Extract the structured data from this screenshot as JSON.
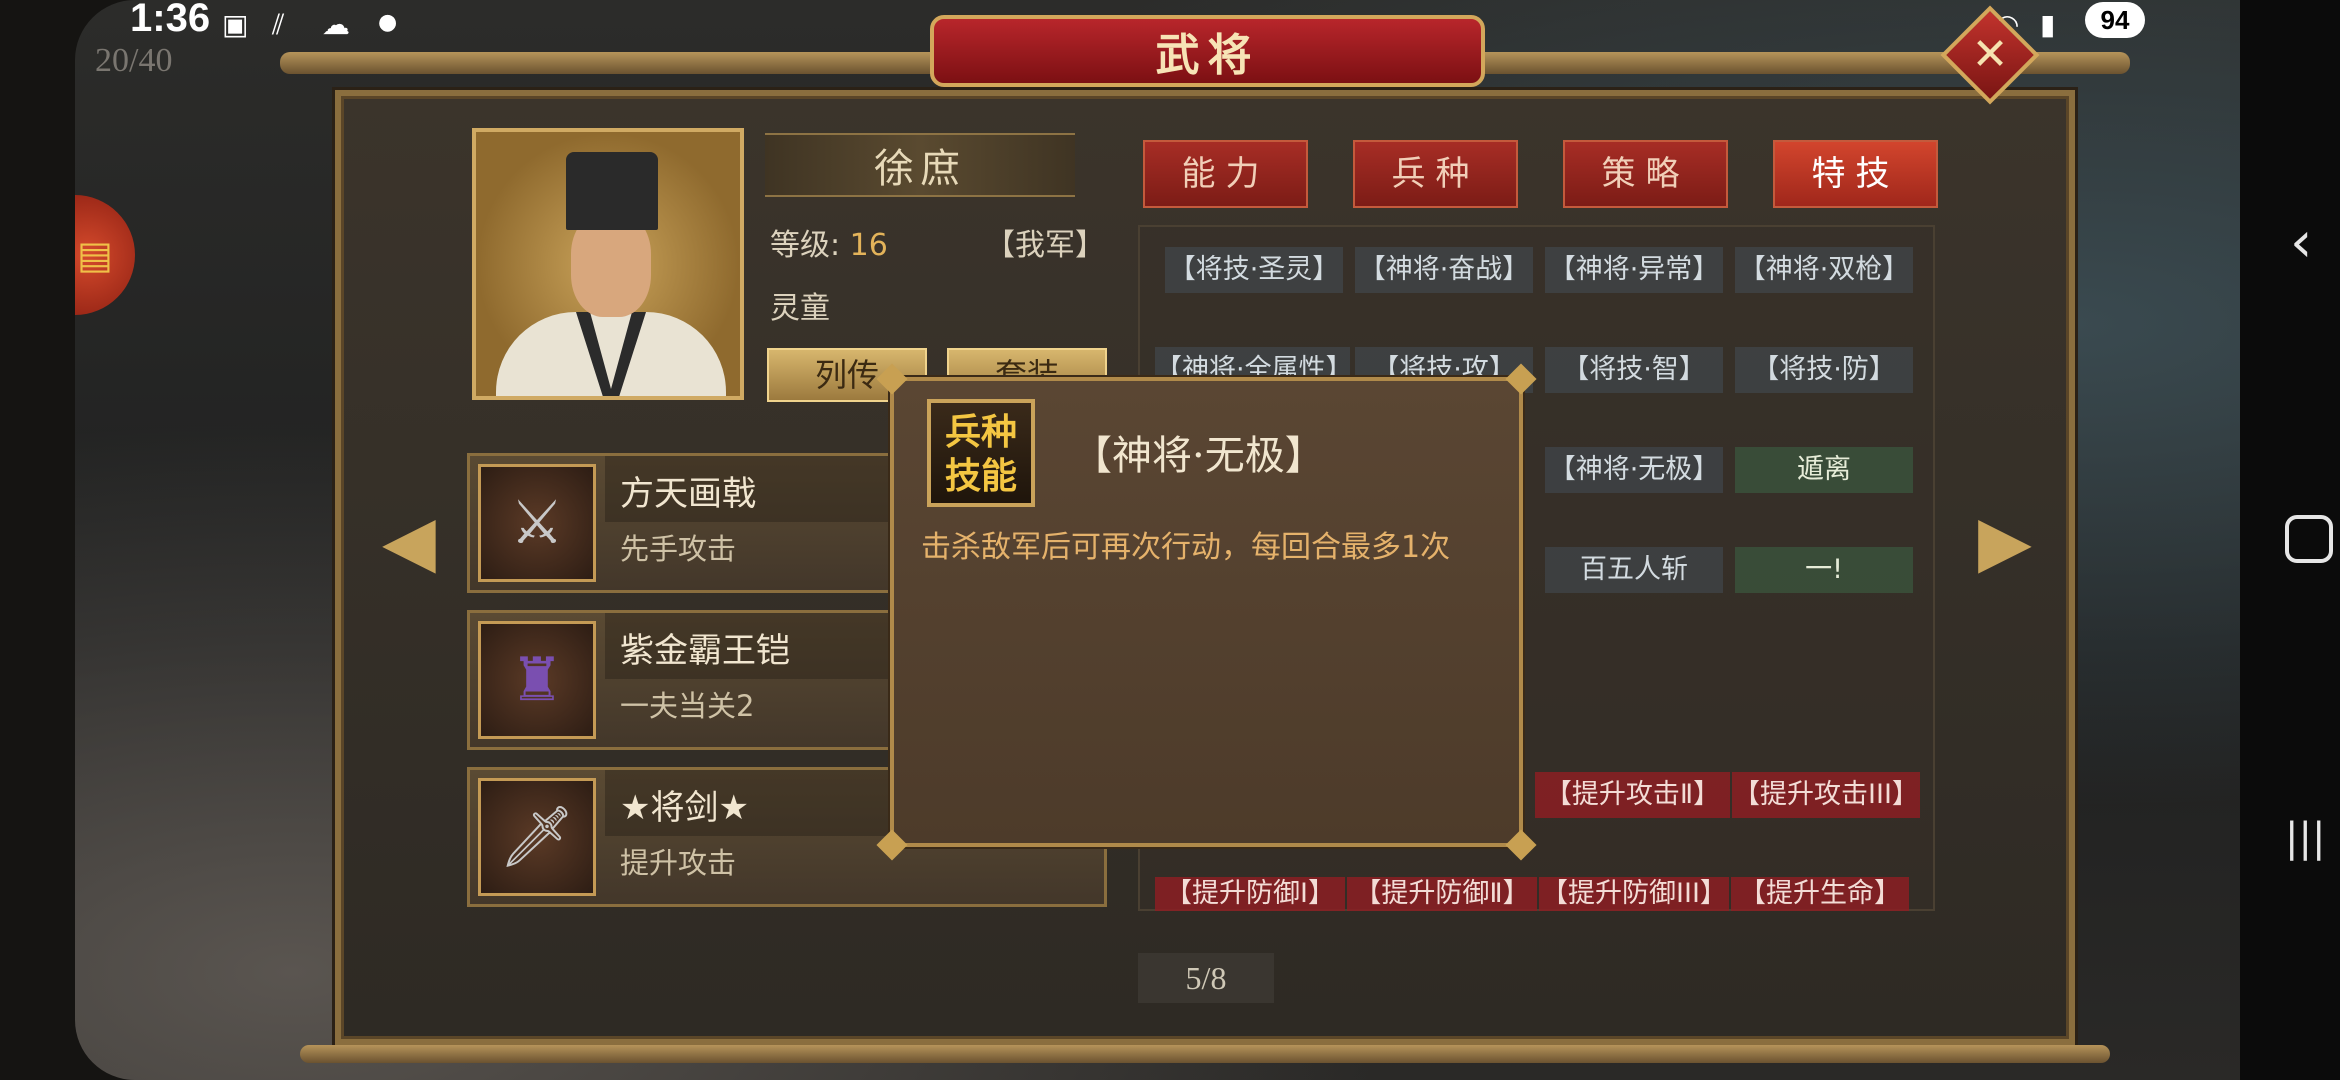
{
  "status_bar": {
    "time": "1:36",
    "battery": "94",
    "icons": [
      "screenshot-icon",
      "signal-bars-icon",
      "wechat-icon",
      "dot-icon",
      "wifi-icon",
      "cell-signal-icon"
    ]
  },
  "counter": "20/40",
  "window": {
    "title": "武将",
    "close_icon": "close-icon"
  },
  "general": {
    "name": "徐庶",
    "level_label": "等级:",
    "level_value": "16",
    "faction": "【我军】",
    "class": "灵童",
    "biography_button": "列传",
    "equip_button": "套装"
  },
  "tabs": [
    {
      "label": "能力",
      "active": false
    },
    {
      "label": "兵种",
      "active": false
    },
    {
      "label": "策略",
      "active": false
    },
    {
      "label": "特技",
      "active": true
    }
  ],
  "skills": {
    "row1": [
      "【将技·圣灵】",
      "【神将·奋战】",
      "【神将·异常】",
      "【神将·双枪】"
    ],
    "row2": [
      "【神将·全属性】",
      "【将技·攻】",
      "【将技·智】",
      "【将技·防】"
    ],
    "row3": [
      "【神将·无极】",
      "遁离"
    ],
    "row4": [
      "百五人斩",
      "一!"
    ],
    "row5": [
      "【提升攻击Ⅱ】",
      "【提升攻击III】"
    ],
    "row6": [
      "【提升防御Ⅰ】",
      "【提升防御Ⅱ】",
      "【提升防御III】",
      "【提升生命】"
    ]
  },
  "equipment": [
    {
      "name": "方天画戟",
      "effect": "先手攻击",
      "icon": "halberd-icon"
    },
    {
      "name": "紫金霸王铠",
      "effect": "一夫当关2",
      "icon": "armor-icon"
    },
    {
      "name": "★将剑★",
      "effect": "提升攻击",
      "icon": "sword-icon"
    }
  ],
  "popup": {
    "badge_line1": "兵种",
    "badge_line2": "技能",
    "title": "【神将·无极】",
    "description": "击杀敌军后可再次行动，每回合最多1次"
  },
  "pagination": "5/8",
  "colors": {
    "accent_red": "#a72d25",
    "gold": "#caa35a",
    "skill_text": "#e5b26b"
  }
}
